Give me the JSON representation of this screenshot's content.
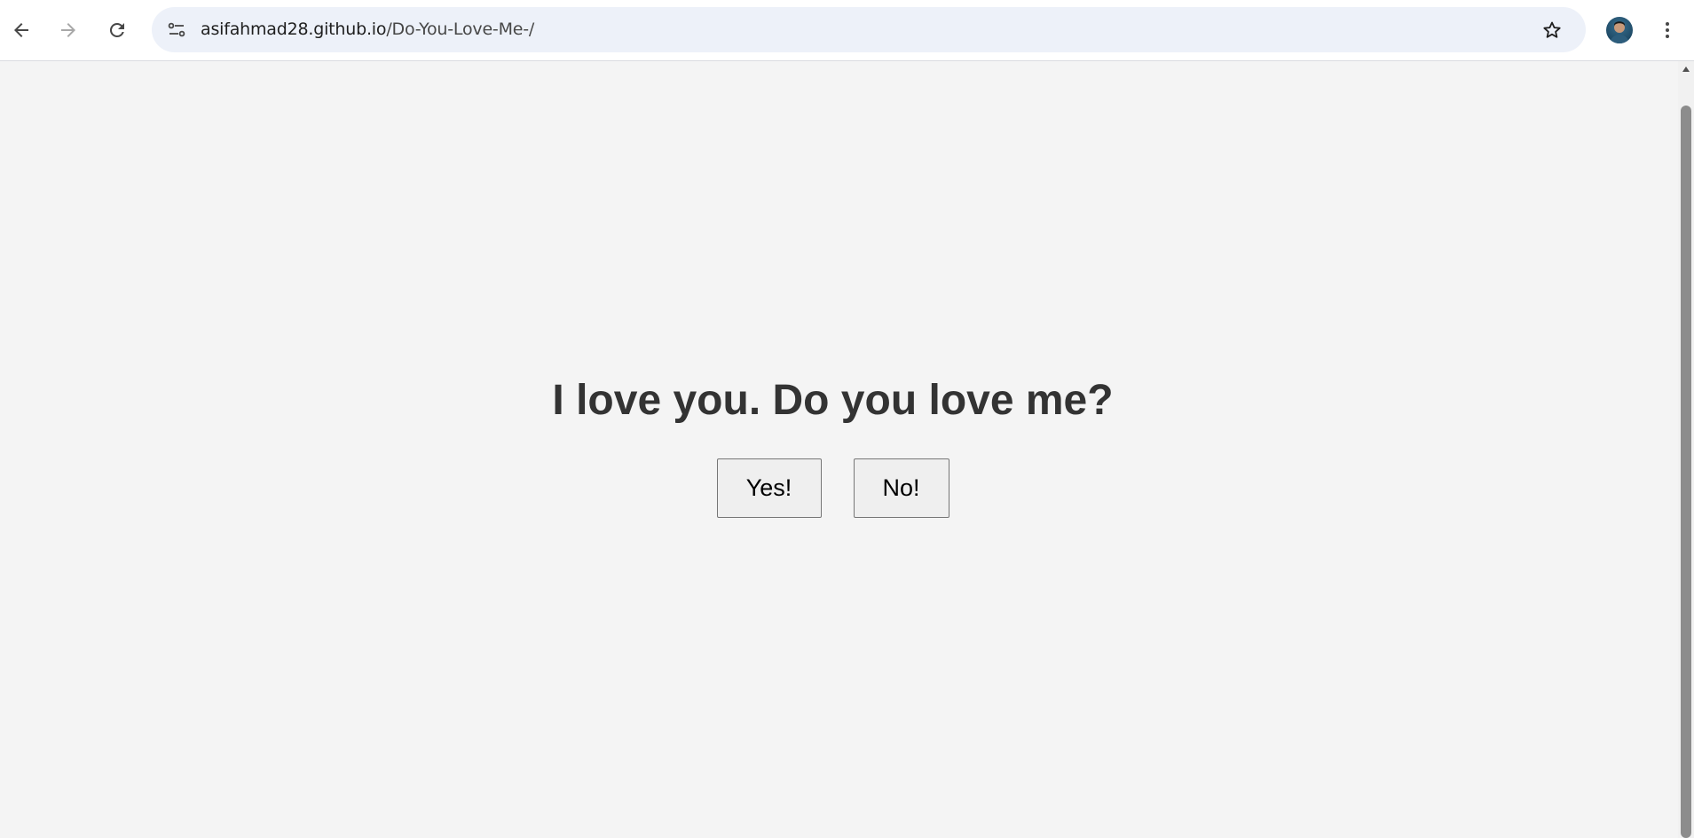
{
  "browser": {
    "url_host": "asifahmad28.github.io",
    "url_path": "/Do-You-Love-Me-/",
    "icons": {
      "back": "back-arrow-icon",
      "forward": "forward-arrow-icon",
      "reload": "reload-icon",
      "site_info": "tune-icon",
      "bookmark": "star-icon",
      "menu": "three-dot-menu-icon"
    }
  },
  "page": {
    "question": "I love you. Do you love me?",
    "yes_label": "Yes!",
    "no_label": "No!"
  },
  "colors": {
    "page_background": "#f4f4f4",
    "question_text": "#333333",
    "button_background": "#efefef",
    "button_border": "#767676"
  }
}
